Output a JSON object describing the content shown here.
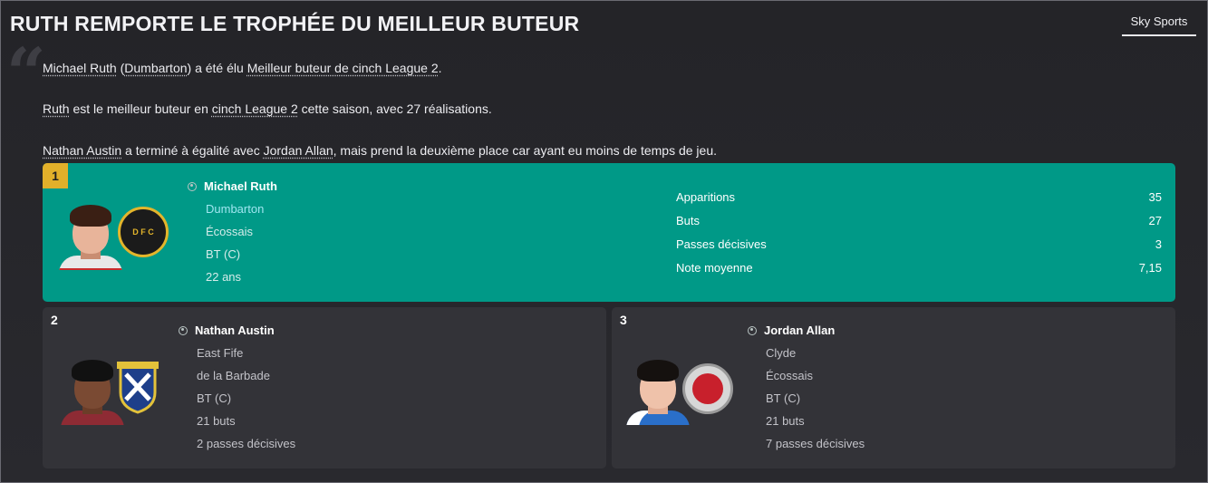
{
  "header": {
    "title": "RUTH REMPORTE LE TROPHÉE DU MEILLEUR BUTEUR",
    "source_tab": "Sky Sports"
  },
  "quote_mark": "“",
  "paragraphs": {
    "p1": {
      "player": "Michael Ruth",
      "open_paren": " (",
      "club": "Dumbarton",
      "mid": ") a été élu ",
      "award": "Meilleur buteur de cinch League 2",
      "end": "."
    },
    "p2": {
      "player": "Ruth",
      "mid": " est le meilleur buteur en ",
      "league": "cinch League 2",
      "end": " cette saison, avec 27 réalisations."
    },
    "p3": {
      "player1": "Nathan Austin",
      "mid": " a terminé à égalité avec ",
      "player2": "Jordan Allan",
      "end": ", mais prend la deuxième place car ayant eu moins de temps de jeu."
    }
  },
  "winner": {
    "rank": "1",
    "name": "Michael Ruth",
    "club": "Dumbarton",
    "nationality": "Écossais",
    "position": "BT (C)",
    "age": "22 ans",
    "club_badge_text": "D F C",
    "stats": [
      {
        "label": "Apparitions",
        "value": "35"
      },
      {
        "label": "Buts",
        "value": "27"
      },
      {
        "label": "Passes décisives",
        "value": "3"
      },
      {
        "label": "Note moyenne",
        "value": "7,15"
      }
    ]
  },
  "runners_up": [
    {
      "rank": "2",
      "name": "Nathan Austin",
      "club": "East Fife",
      "nationality": "de la Barbade",
      "position": "BT (C)",
      "goals": "21 buts",
      "assists": "2 passes décisives"
    },
    {
      "rank": "3",
      "name": "Jordan Allan",
      "club": "Clyde",
      "nationality": "Écossais",
      "position": "BT (C)",
      "goals": "21 buts",
      "assists": "7 passes décisives"
    }
  ],
  "colors": {
    "winner_bg": "#009987",
    "rank_gold": "#e2b02a",
    "card_bg": "#333338",
    "page_bg": "#27272c"
  }
}
